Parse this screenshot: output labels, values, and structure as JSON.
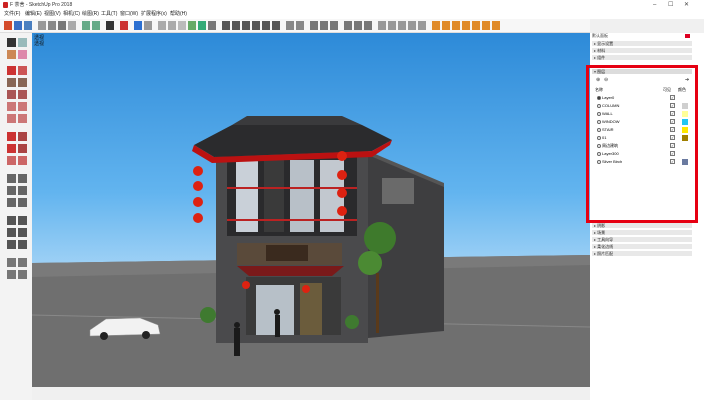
{
  "window": {
    "title": "F 茶舍 - SketchUp Pro 2018",
    "minimize": "–",
    "maximize": "☐",
    "close": "✕"
  },
  "menu": [
    "文件(F)",
    "编辑(E)",
    "视图(V)",
    "相机(C)",
    "绘图(R)",
    "工具(T)",
    "窗口(W)",
    "扩展程序(x)",
    "帮助(H)"
  ],
  "viewport": {
    "label1": "透视",
    "label2": "透视"
  },
  "colors": {
    "highlight": "#e60012",
    "sky": "#4aa3e8",
    "ground": "#6f6f6f"
  },
  "tray": {
    "title": "默认面板",
    "sections_top": [
      "显示设置",
      "材料",
      "组件"
    ],
    "tags_panel": {
      "title": "图层",
      "headers": {
        "name": "名称",
        "visible": "可见",
        "color": "颜色"
      },
      "rows": [
        {
          "name": "Layer0",
          "active": true,
          "visible": "✓",
          "color": "#ffffff"
        },
        {
          "name": "COLUMN",
          "active": false,
          "visible": "✓",
          "color": "#cfcfcf"
        },
        {
          "name": "WALL",
          "active": false,
          "visible": "✓",
          "color": "#ffff99"
        },
        {
          "name": "WINDOW",
          "active": false,
          "visible": "✓",
          "color": "#22c6f2"
        },
        {
          "name": "STAIR",
          "active": false,
          "visible": "✓",
          "color": "#ffe800"
        },
        {
          "name": "01",
          "active": false,
          "visible": "✓",
          "color": "#a08000"
        },
        {
          "name": "周边建筑",
          "active": false,
          "visible": "✓",
          "color": "#ffffff"
        },
        {
          "name": "Layer300",
          "active": false,
          "visible": "✓",
          "color": "#ffffff"
        },
        {
          "name": "Silver Birch",
          "active": false,
          "visible": "✓",
          "color": "#6a7aa0"
        }
      ]
    },
    "sections_bottom": [
      "阴影",
      "场景",
      "工具向导",
      "柔化边线",
      "照片匹配"
    ]
  }
}
